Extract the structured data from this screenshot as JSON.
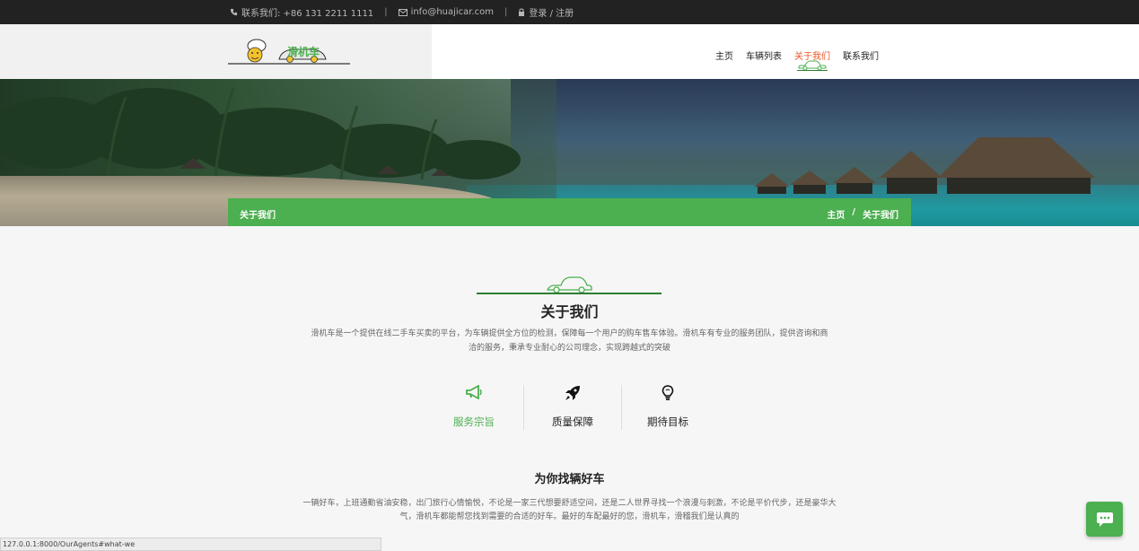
{
  "topbar": {
    "contact_label": "联系我们: +86 131 2211 1111",
    "separator": "|",
    "email": "info@huajicar.com",
    "login_label": "登录 / 注册"
  },
  "header": {
    "logo_text": "滑机车",
    "nav": [
      {
        "label": "主页"
      },
      {
        "label": "车辆列表"
      },
      {
        "label": "关于我们",
        "active": true
      },
      {
        "label": "联系我们"
      }
    ],
    "active_color": "#e8572a"
  },
  "hero": {
    "title": "关于我们",
    "crumb_title": "关于我们",
    "breadcrumb_home": "主页",
    "breadcrumb_sep": "/",
    "breadcrumb_current": "关于我们",
    "accent": "#4caf50"
  },
  "about": {
    "title": "关于我们",
    "description": "滑机车是一个提供在线二手车买卖的平台，为车辆提供全方位的检测，保障每一个用户的购车售车体验。滑机车有专业的服务团队，提供咨询和商洽的服务，秉承专业耐心的公司理念，实现跨越式的突破"
  },
  "features": [
    {
      "label": "服务宗旨",
      "icon": "megaphone-icon",
      "active": true
    },
    {
      "label": "质量保障",
      "icon": "rocket-icon",
      "active": false
    },
    {
      "label": "期待目标",
      "icon": "lightbulb-icon",
      "active": false
    }
  ],
  "find": {
    "title": "为你找辆好车",
    "description": "一辆好车，上班通勤省油安稳，出门旅行心情愉悦，不论是一家三代想要舒适空间，还是二人世界寻找一个浪漫与刺激，不论是平价代步，还是豪华大气，滑机车都能帮您找到需要的合适的好车。最好的车配最好的您，滑机车，滑稽我们是认真的"
  },
  "status_url": "127.0.0.1:8000/OurAgents#what-we",
  "chat": {
    "icon": "chat-icon"
  }
}
